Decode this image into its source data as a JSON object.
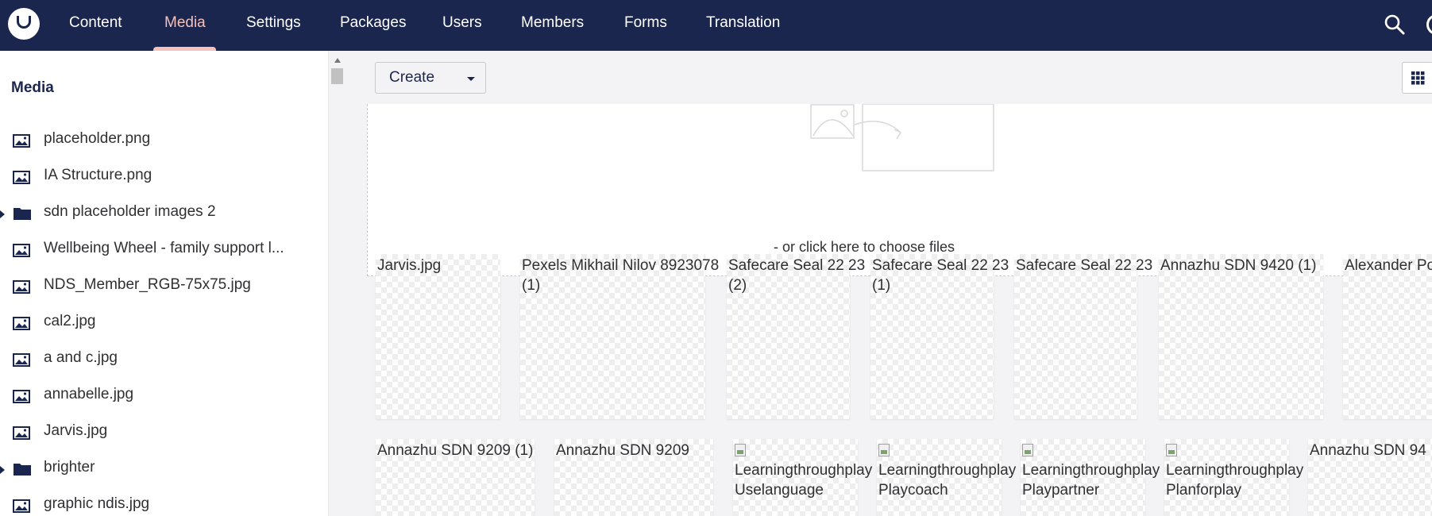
{
  "header": {
    "nav": [
      {
        "label": "Content",
        "active": false
      },
      {
        "label": "Media",
        "active": true
      },
      {
        "label": "Settings",
        "active": false
      },
      {
        "label": "Packages",
        "active": false
      },
      {
        "label": "Users",
        "active": false
      },
      {
        "label": "Members",
        "active": false
      },
      {
        "label": "Forms",
        "active": false
      },
      {
        "label": "Translation",
        "active": false
      }
    ],
    "icons": [
      "umbraco-logo-icon",
      "search-icon",
      "help-icon"
    ],
    "colors": {
      "background": "#1b264f",
      "active": "#f5c1bc",
      "text": "#ffffff"
    }
  },
  "tree": {
    "title": "Media",
    "items": [
      {
        "label": "placeholder.png",
        "icon": "image-icon",
        "expandable": false
      },
      {
        "label": "IA Structure.png",
        "icon": "image-icon",
        "expandable": false
      },
      {
        "label": "sdn placeholder images 2",
        "icon": "folder-icon",
        "expandable": true
      },
      {
        "label": "Wellbeing Wheel - family support l...",
        "icon": "image-icon",
        "expandable": false
      },
      {
        "label": "NDS_Member_RGB-75x75.jpg",
        "icon": "image-icon",
        "expandable": false
      },
      {
        "label": "cal2.jpg",
        "icon": "image-icon",
        "expandable": false
      },
      {
        "label": "a and c.jpg",
        "icon": "image-icon",
        "expandable": false
      },
      {
        "label": "annabelle.jpg",
        "icon": "image-icon",
        "expandable": false
      },
      {
        "label": "Jarvis.jpg",
        "icon": "image-icon",
        "expandable": false
      },
      {
        "label": "brighter",
        "icon": "folder-icon",
        "expandable": true
      },
      {
        "label": "graphic ndis.jpg",
        "icon": "image-icon",
        "expandable": false
      }
    ]
  },
  "toolbar": {
    "create_label": "Create",
    "view_icon": "grid-icon"
  },
  "dropzone": {
    "text": "- or click here to choose files"
  },
  "media_grid": {
    "row1": [
      {
        "alt": "Jarvis.jpg",
        "broken_icon": false
      },
      {
        "alt": "Pexels Mikhail Nilov 8923078 (1)",
        "broken_icon": false
      },
      {
        "alt": "Safecare Seal 22 23 (2)",
        "broken_icon": false
      },
      {
        "alt": "Safecare Seal 22 23 (1)",
        "broken_icon": false
      },
      {
        "alt": "Safecare Seal 22 23",
        "broken_icon": false
      },
      {
        "alt": "Annazhu SDN 9420 (1)",
        "broken_icon": false
      },
      {
        "alt": "Alexander Portrait",
        "broken_icon": false
      }
    ],
    "row2": [
      {
        "alt": "Annazhu SDN 9209 (1)",
        "broken_icon": false
      },
      {
        "alt": "Annazhu SDN 9209",
        "broken_icon": false
      },
      {
        "alt": "Learningthroughplay Icon Uselanguage",
        "broken_icon": true
      },
      {
        "alt": "Learningthroughplay Icon Playcoach",
        "broken_icon": true
      },
      {
        "alt": "Learningthroughplay Icon Playpartner",
        "broken_icon": true
      },
      {
        "alt": "Learningthroughplay Icon Planforplay",
        "broken_icon": true
      },
      {
        "alt": "Annazhu SDN 94",
        "broken_icon": false
      }
    ]
  }
}
